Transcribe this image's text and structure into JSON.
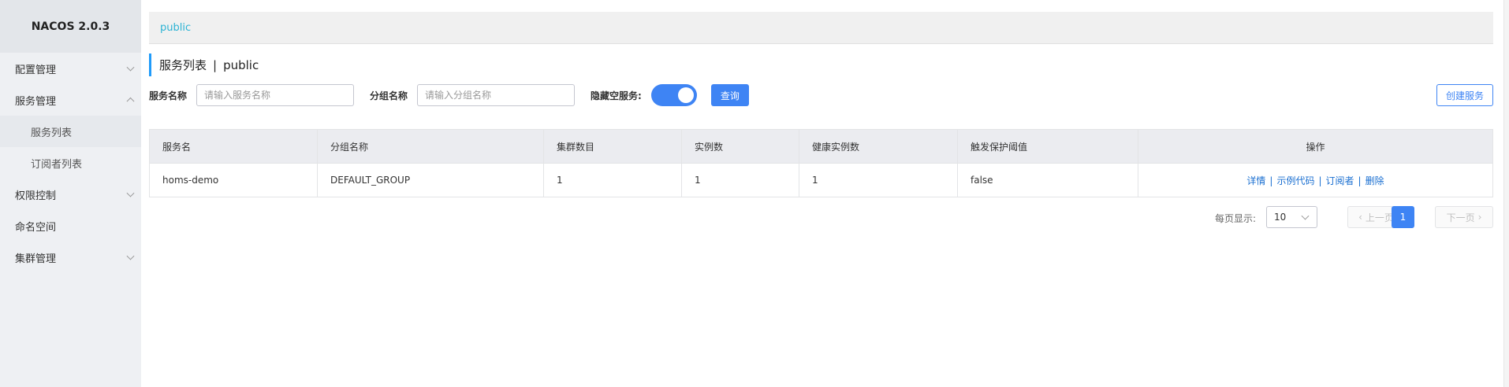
{
  "sidebar": {
    "brand": "NACOS 2.0.3",
    "items": [
      {
        "label": "配置管理"
      },
      {
        "label": "服务管理"
      },
      {
        "label": "服务列表"
      },
      {
        "label": "订阅者列表"
      },
      {
        "label": "权限控制"
      },
      {
        "label": "命名空间"
      },
      {
        "label": "集群管理"
      }
    ]
  },
  "topbar": {
    "namespace": "public"
  },
  "title": {
    "main": "服务列表",
    "separator": "|",
    "namespace": "public"
  },
  "filters": {
    "service_name_label": "服务名称",
    "service_name_placeholder": "请输入服务名称",
    "service_name_value": "",
    "group_name_label": "分组名称",
    "group_name_placeholder": "请输入分组名称",
    "group_name_value": "",
    "hide_empty_label": "隐藏空服务:",
    "hide_empty_enabled": true,
    "query_label": "查询",
    "create_label": "创建服务"
  },
  "table": {
    "headers": [
      "服务名",
      "分组名称",
      "集群数目",
      "实例数",
      "健康实例数",
      "触发保护阈值",
      "操作"
    ],
    "rows": [
      {
        "service": "homs-demo",
        "group": "DEFAULT_GROUP",
        "clusters": "1",
        "instances": "1",
        "healthy": "1",
        "threshold": "false",
        "ops": {
          "detail": "详情",
          "sample": "示例代码",
          "subscribers": "订阅者",
          "delete": "删除"
        }
      }
    ]
  },
  "pagination": {
    "page_size_label": "每页显示:",
    "page_size": "10",
    "prev_label": "上一页",
    "next_label": "下一页",
    "current_page": "1"
  },
  "colors": {
    "accent": "#3e84f4",
    "namespace_text": "#2bb3d4",
    "link": "#1a6fd1",
    "sidebar_bg": "#eef0f3"
  }
}
